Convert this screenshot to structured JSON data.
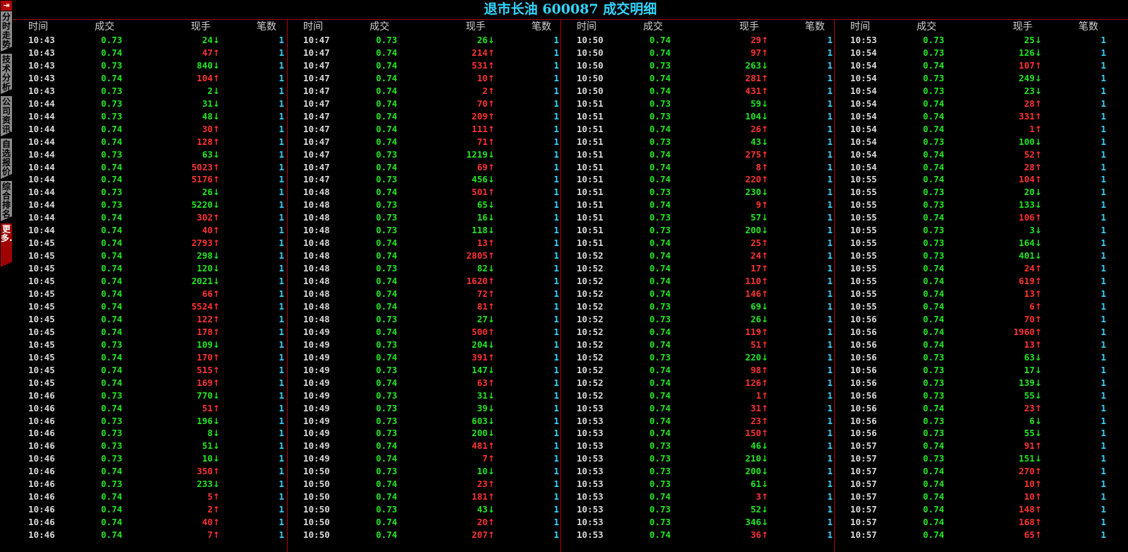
{
  "title": "退市长油 600087 成交明细",
  "sidebar": {
    "top_icon": "exit-icon",
    "tabs": [
      "分时走势",
      "技术分析",
      "公司资讯",
      "自选报价",
      "综合排名",
      "更多..."
    ]
  },
  "headers": {
    "time": "时间",
    "price": "成交",
    "volume": "现手",
    "count": "笔数"
  },
  "colors": {
    "up": "#ff3232",
    "down": "#22e622",
    "title": "#33d6ff",
    "line": "#b00000"
  },
  "panels": [
    [
      [
        "10:43",
        "0.73",
        "24",
        "d",
        "1"
      ],
      [
        "10:43",
        "0.74",
        "47",
        "u",
        "1"
      ],
      [
        "10:43",
        "0.73",
        "840",
        "d",
        "1"
      ],
      [
        "10:43",
        "0.74",
        "104",
        "u",
        "1"
      ],
      [
        "10:43",
        "0.73",
        "2",
        "d",
        "1"
      ],
      [
        "10:44",
        "0.73",
        "31",
        "d",
        "1"
      ],
      [
        "10:44",
        "0.73",
        "48",
        "d",
        "1"
      ],
      [
        "10:44",
        "0.74",
        "30",
        "u",
        "1"
      ],
      [
        "10:44",
        "0.74",
        "128",
        "u",
        "1"
      ],
      [
        "10:44",
        "0.73",
        "63",
        "d",
        "1"
      ],
      [
        "10:44",
        "0.74",
        "5023",
        "u",
        "1"
      ],
      [
        "10:44",
        "0.74",
        "5176",
        "u",
        "1"
      ],
      [
        "10:44",
        "0.73",
        "26",
        "d",
        "1"
      ],
      [
        "10:44",
        "0.73",
        "5220",
        "d",
        "1"
      ],
      [
        "10:44",
        "0.74",
        "302",
        "u",
        "1"
      ],
      [
        "10:44",
        "0.74",
        "40",
        "u",
        "1"
      ],
      [
        "10:45",
        "0.74",
        "2793",
        "u",
        "1"
      ],
      [
        "10:45",
        "0.74",
        "298",
        "d",
        "1"
      ],
      [
        "10:45",
        "0.74",
        "120",
        "d",
        "1"
      ],
      [
        "10:45",
        "0.74",
        "2021",
        "d",
        "1"
      ],
      [
        "10:45",
        "0.74",
        "66",
        "u",
        "1"
      ],
      [
        "10:45",
        "0.74",
        "5524",
        "u",
        "1"
      ],
      [
        "10:45",
        "0.74",
        "122",
        "u",
        "1"
      ],
      [
        "10:45",
        "0.74",
        "178",
        "u",
        "1"
      ],
      [
        "10:45",
        "0.73",
        "109",
        "d",
        "1"
      ],
      [
        "10:45",
        "0.74",
        "170",
        "u",
        "1"
      ],
      [
        "10:45",
        "0.74",
        "515",
        "u",
        "1"
      ],
      [
        "10:45",
        "0.74",
        "169",
        "u",
        "1"
      ],
      [
        "10:46",
        "0.73",
        "770",
        "d",
        "1"
      ],
      [
        "10:46",
        "0.74",
        "51",
        "u",
        "1"
      ],
      [
        "10:46",
        "0.73",
        "196",
        "d",
        "1"
      ],
      [
        "10:46",
        "0.73",
        "8",
        "d",
        "1"
      ],
      [
        "10:46",
        "0.73",
        "51",
        "d",
        "1"
      ],
      [
        "10:46",
        "0.73",
        "10",
        "d",
        "1"
      ],
      [
        "10:46",
        "0.74",
        "350",
        "u",
        "1"
      ],
      [
        "10:46",
        "0.73",
        "233",
        "d",
        "1"
      ],
      [
        "10:46",
        "0.74",
        "5",
        "u",
        "1"
      ],
      [
        "10:46",
        "0.74",
        "2",
        "u",
        "1"
      ],
      [
        "10:46",
        "0.74",
        "40",
        "u",
        "1"
      ],
      [
        "10:46",
        "0.74",
        "7",
        "u",
        "1"
      ]
    ],
    [
      [
        "10:47",
        "0.73",
        "26",
        "d",
        "1"
      ],
      [
        "10:47",
        "0.74",
        "214",
        "u",
        "1"
      ],
      [
        "10:47",
        "0.74",
        "531",
        "u",
        "1"
      ],
      [
        "10:47",
        "0.74",
        "10",
        "u",
        "1"
      ],
      [
        "10:47",
        "0.74",
        "2",
        "u",
        "1"
      ],
      [
        "10:47",
        "0.74",
        "70",
        "u",
        "1"
      ],
      [
        "10:47",
        "0.74",
        "209",
        "u",
        "1"
      ],
      [
        "10:47",
        "0.74",
        "111",
        "u",
        "1"
      ],
      [
        "10:47",
        "0.74",
        "71",
        "u",
        "1"
      ],
      [
        "10:47",
        "0.73",
        "1219",
        "d",
        "1"
      ],
      [
        "10:47",
        "0.74",
        "69",
        "u",
        "1"
      ],
      [
        "10:47",
        "0.73",
        "456",
        "d",
        "1"
      ],
      [
        "10:48",
        "0.74",
        "501",
        "u",
        "1"
      ],
      [
        "10:48",
        "0.73",
        "65",
        "d",
        "1"
      ],
      [
        "10:48",
        "0.73",
        "16",
        "d",
        "1"
      ],
      [
        "10:48",
        "0.73",
        "118",
        "d",
        "1"
      ],
      [
        "10:48",
        "0.74",
        "13",
        "u",
        "1"
      ],
      [
        "10:48",
        "0.74",
        "2805",
        "u",
        "1"
      ],
      [
        "10:48",
        "0.73",
        "82",
        "d",
        "1"
      ],
      [
        "10:48",
        "0.74",
        "1620",
        "u",
        "1"
      ],
      [
        "10:48",
        "0.74",
        "72",
        "u",
        "1"
      ],
      [
        "10:48",
        "0.74",
        "81",
        "u",
        "1"
      ],
      [
        "10:48",
        "0.73",
        "27",
        "d",
        "1"
      ],
      [
        "10:49",
        "0.74",
        "500",
        "u",
        "1"
      ],
      [
        "10:49",
        "0.73",
        "204",
        "d",
        "1"
      ],
      [
        "10:49",
        "0.74",
        "391",
        "u",
        "1"
      ],
      [
        "10:49",
        "0.73",
        "147",
        "d",
        "1"
      ],
      [
        "10:49",
        "0.74",
        "63",
        "u",
        "1"
      ],
      [
        "10:49",
        "0.73",
        "31",
        "d",
        "1"
      ],
      [
        "10:49",
        "0.73",
        "39",
        "d",
        "1"
      ],
      [
        "10:49",
        "0.73",
        "603",
        "d",
        "1"
      ],
      [
        "10:49",
        "0.73",
        "200",
        "d",
        "1"
      ],
      [
        "10:49",
        "0.74",
        "481",
        "u",
        "1"
      ],
      [
        "10:49",
        "0.74",
        "7",
        "u",
        "1"
      ],
      [
        "10:50",
        "0.73",
        "10",
        "d",
        "1"
      ],
      [
        "10:50",
        "0.74",
        "23",
        "u",
        "1"
      ],
      [
        "10:50",
        "0.74",
        "181",
        "u",
        "1"
      ],
      [
        "10:50",
        "0.73",
        "43",
        "d",
        "1"
      ],
      [
        "10:50",
        "0.74",
        "20",
        "u",
        "1"
      ],
      [
        "10:50",
        "0.74",
        "207",
        "u",
        "1"
      ]
    ],
    [
      [
        "10:50",
        "0.74",
        "29",
        "u",
        "1"
      ],
      [
        "10:50",
        "0.74",
        "97",
        "u",
        "1"
      ],
      [
        "10:50",
        "0.73",
        "263",
        "d",
        "1"
      ],
      [
        "10:50",
        "0.74",
        "281",
        "u",
        "1"
      ],
      [
        "10:50",
        "0.74",
        "431",
        "u",
        "1"
      ],
      [
        "10:51",
        "0.73",
        "59",
        "d",
        "1"
      ],
      [
        "10:51",
        "0.73",
        "104",
        "d",
        "1"
      ],
      [
        "10:51",
        "0.74",
        "26",
        "u",
        "1"
      ],
      [
        "10:51",
        "0.73",
        "43",
        "d",
        "1"
      ],
      [
        "10:51",
        "0.74",
        "275",
        "u",
        "1"
      ],
      [
        "10:51",
        "0.74",
        "8",
        "u",
        "1"
      ],
      [
        "10:51",
        "0.74",
        "220",
        "u",
        "1"
      ],
      [
        "10:51",
        "0.73",
        "230",
        "d",
        "1"
      ],
      [
        "10:51",
        "0.74",
        "9",
        "u",
        "1"
      ],
      [
        "10:51",
        "0.73",
        "57",
        "d",
        "1"
      ],
      [
        "10:51",
        "0.73",
        "200",
        "d",
        "1"
      ],
      [
        "10:51",
        "0.74",
        "25",
        "u",
        "1"
      ],
      [
        "10:52",
        "0.74",
        "24",
        "u",
        "1"
      ],
      [
        "10:52",
        "0.74",
        "17",
        "u",
        "1"
      ],
      [
        "10:52",
        "0.74",
        "110",
        "u",
        "1"
      ],
      [
        "10:52",
        "0.74",
        "146",
        "u",
        "1"
      ],
      [
        "10:52",
        "0.73",
        "69",
        "d",
        "1"
      ],
      [
        "10:52",
        "0.73",
        "26",
        "d",
        "1"
      ],
      [
        "10:52",
        "0.74",
        "119",
        "u",
        "1"
      ],
      [
        "10:52",
        "0.74",
        "51",
        "u",
        "1"
      ],
      [
        "10:52",
        "0.73",
        "220",
        "d",
        "1"
      ],
      [
        "10:52",
        "0.74",
        "98",
        "u",
        "1"
      ],
      [
        "10:52",
        "0.74",
        "126",
        "u",
        "1"
      ],
      [
        "10:52",
        "0.74",
        "1",
        "u",
        "1"
      ],
      [
        "10:53",
        "0.74",
        "31",
        "u",
        "1"
      ],
      [
        "10:53",
        "0.74",
        "23",
        "u",
        "1"
      ],
      [
        "10:53",
        "0.74",
        "150",
        "u",
        "1"
      ],
      [
        "10:53",
        "0.73",
        "46",
        "d",
        "1"
      ],
      [
        "10:53",
        "0.73",
        "210",
        "d",
        "1"
      ],
      [
        "10:53",
        "0.73",
        "200",
        "d",
        "1"
      ],
      [
        "10:53",
        "0.73",
        "61",
        "d",
        "1"
      ],
      [
        "10:53",
        "0.74",
        "3",
        "u",
        "1"
      ],
      [
        "10:53",
        "0.73",
        "52",
        "d",
        "1"
      ],
      [
        "10:53",
        "0.73",
        "346",
        "d",
        "1"
      ],
      [
        "10:53",
        "0.74",
        "36",
        "u",
        "1"
      ]
    ],
    [
      [
        "10:53",
        "0.73",
        "25",
        "d",
        "1"
      ],
      [
        "10:54",
        "0.73",
        "126",
        "d",
        "1"
      ],
      [
        "10:54",
        "0.74",
        "107",
        "u",
        "1"
      ],
      [
        "10:54",
        "0.73",
        "249",
        "d",
        "1"
      ],
      [
        "10:54",
        "0.73",
        "23",
        "d",
        "1"
      ],
      [
        "10:54",
        "0.74",
        "28",
        "u",
        "1"
      ],
      [
        "10:54",
        "0.74",
        "331",
        "u",
        "1"
      ],
      [
        "10:54",
        "0.74",
        "1",
        "u",
        "1"
      ],
      [
        "10:54",
        "0.73",
        "100",
        "d",
        "1"
      ],
      [
        "10:54",
        "0.74",
        "52",
        "u",
        "1"
      ],
      [
        "10:54",
        "0.74",
        "28",
        "u",
        "1"
      ],
      [
        "10:55",
        "0.74",
        "104",
        "u",
        "1"
      ],
      [
        "10:55",
        "0.73",
        "20",
        "d",
        "1"
      ],
      [
        "10:55",
        "0.73",
        "133",
        "d",
        "1"
      ],
      [
        "10:55",
        "0.74",
        "106",
        "u",
        "1"
      ],
      [
        "10:55",
        "0.73",
        "3",
        "d",
        "1"
      ],
      [
        "10:55",
        "0.73",
        "164",
        "d",
        "1"
      ],
      [
        "10:55",
        "0.73",
        "401",
        "d",
        "1"
      ],
      [
        "10:55",
        "0.74",
        "24",
        "u",
        "1"
      ],
      [
        "10:55",
        "0.74",
        "619",
        "u",
        "1"
      ],
      [
        "10:55",
        "0.74",
        "13",
        "u",
        "1"
      ],
      [
        "10:55",
        "0.74",
        "6",
        "u",
        "1"
      ],
      [
        "10:56",
        "0.74",
        "70",
        "u",
        "1"
      ],
      [
        "10:56",
        "0.74",
        "1960",
        "u",
        "1"
      ],
      [
        "10:56",
        "0.74",
        "13",
        "u",
        "1"
      ],
      [
        "10:56",
        "0.73",
        "63",
        "d",
        "1"
      ],
      [
        "10:56",
        "0.73",
        "17",
        "d",
        "1"
      ],
      [
        "10:56",
        "0.73",
        "139",
        "d",
        "1"
      ],
      [
        "10:56",
        "0.73",
        "55",
        "d",
        "1"
      ],
      [
        "10:56",
        "0.74",
        "23",
        "u",
        "1"
      ],
      [
        "10:56",
        "0.73",
        "6",
        "d",
        "1"
      ],
      [
        "10:56",
        "0.73",
        "55",
        "d",
        "1"
      ],
      [
        "10:57",
        "0.74",
        "91",
        "u",
        "1"
      ],
      [
        "10:57",
        "0.73",
        "151",
        "d",
        "1"
      ],
      [
        "10:57",
        "0.74",
        "270",
        "u",
        "1"
      ],
      [
        "10:57",
        "0.74",
        "10",
        "u",
        "1"
      ],
      [
        "10:57",
        "0.74",
        "10",
        "u",
        "1"
      ],
      [
        "10:57",
        "0.74",
        "148",
        "u",
        "1"
      ],
      [
        "10:57",
        "0.74",
        "168",
        "u",
        "1"
      ],
      [
        "10:57",
        "0.74",
        "65",
        "u",
        "1"
      ]
    ]
  ]
}
